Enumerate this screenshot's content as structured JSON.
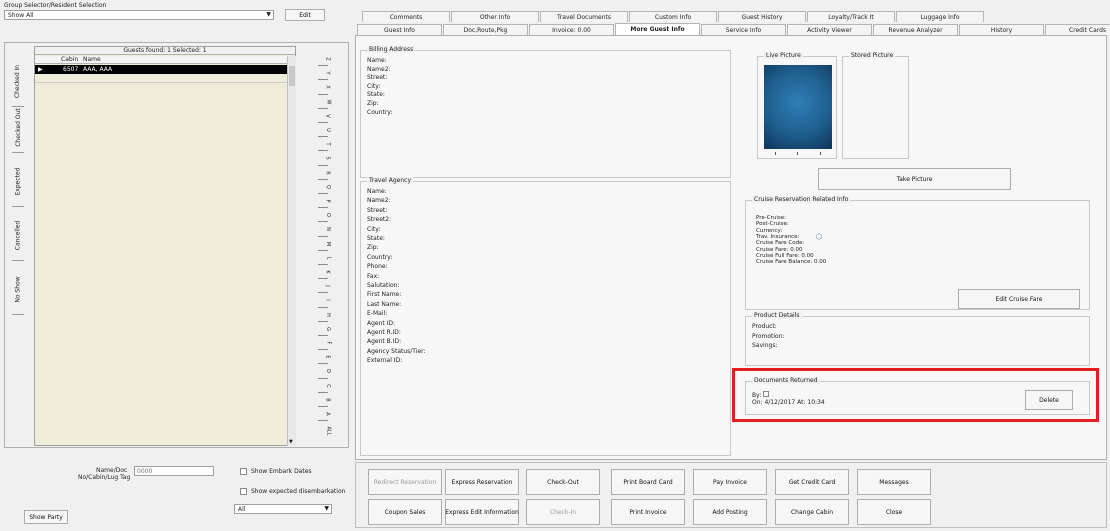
{
  "left_panel": {
    "group_selector_label": "Group Selector/Resident Selection",
    "group_combo_value": "Show All",
    "edit_button": "Edit",
    "guests_found": "Guests found: 1 Selected: 1",
    "columns": [
      "Cabin",
      "Name"
    ],
    "rows": [
      {
        "cabin": "6507",
        "name": "AAA, AAA"
      }
    ],
    "vertical_tabs": [
      "Checked In",
      "Checked Out",
      "Expected",
      "Cancelled",
      "No Show"
    ],
    "alpha_tabs": [
      "ALL",
      "A",
      "B",
      "C",
      "D",
      "E",
      "F",
      "G",
      "H",
      "I",
      "J",
      "K",
      "L",
      "M",
      "N",
      "O",
      "P",
      "Q",
      "R",
      "S",
      "T",
      "U",
      "V",
      "W",
      "X",
      "Y",
      "Z"
    ],
    "search_label_1": "Name/Doc",
    "search_label_2": "No/Cabin/Lug Tag",
    "search_value": "",
    "search_placeholder": "0000",
    "show_embark_dates": "Show Embark Dates",
    "show_expected_disembarkation": "Show expected disembarkation",
    "filter_combo_value": "All",
    "show_party_button": "Show Party"
  },
  "tabs_row1": [
    "Comments",
    "Other Info",
    "Travel Documents",
    "Custom Info",
    "Guest History",
    "Loyalty/Track It",
    "Luggage Info"
  ],
  "tabs_row2": [
    "Guest Info",
    "Doc,Route,Pkg",
    "Invoice: 0.00",
    "More Guest Info",
    "Service Info",
    "Activity Viewer",
    "Revenue Analyzer",
    "History",
    "Credit Cards"
  ],
  "billing": {
    "title": "Billing Address",
    "fields": [
      "Name:",
      "Name2:",
      "Street:",
      "City:",
      "State:",
      "Zip:",
      "Country:"
    ]
  },
  "travel_agency": {
    "title": "Travel Agency",
    "fields": [
      "Name:",
      "Name2:",
      "Street:",
      "Street2:",
      "City:",
      "State:",
      "Zip:",
      "Country:",
      "Phone:",
      "Fax:",
      "Salutation:",
      "First Name:",
      "Last Name:",
      "E-Mail:",
      "Agent ID:",
      "Agent R.ID:",
      "Agent B.ID:",
      "Agency Status/Tier:",
      "External ID:"
    ]
  },
  "pictures": {
    "live_label": "Live Picture",
    "stored_label": "Stored Picture",
    "take_picture_button": "Take Picture"
  },
  "cruise": {
    "title": "Cruise Reservation Related Info",
    "lines": [
      "Pre-Cruise:",
      "Post-Cruise:",
      "Currency:",
      "Trav. Insurance:",
      "Cruise Fare Code:",
      "Cruise Fare: 0.00",
      "Cruise Full Fare: 0.00",
      "Cruise Fare Balance: 0.00"
    ],
    "edit_button": "Edit Cruise Fare"
  },
  "product": {
    "title": "Product Details",
    "fields": [
      "Product:",
      "Promotion:",
      "Savings:"
    ]
  },
  "documents": {
    "title": "Documents Returned",
    "by_label": "By:",
    "on_text": "On: 4/12/2017 At: 10:34",
    "delete_button": "Delete"
  },
  "action_buttons_row1": [
    "Redirect Reservation",
    "Express Reservation",
    "Check-Out",
    "Print Board Card",
    "Pay Invoice",
    "Get Credit Card",
    "Messages"
  ],
  "action_buttons_row2": [
    "Coupon Sales",
    "Express Edit Information",
    "Check-In",
    "Print Invoice",
    "Add Posting",
    "Change Cabin",
    "Close"
  ],
  "colors": {
    "highlight": "#e02020",
    "selected_row": "#000000",
    "grid_bg": "#efecd9",
    "live_picture": "#1f5f8f"
  }
}
